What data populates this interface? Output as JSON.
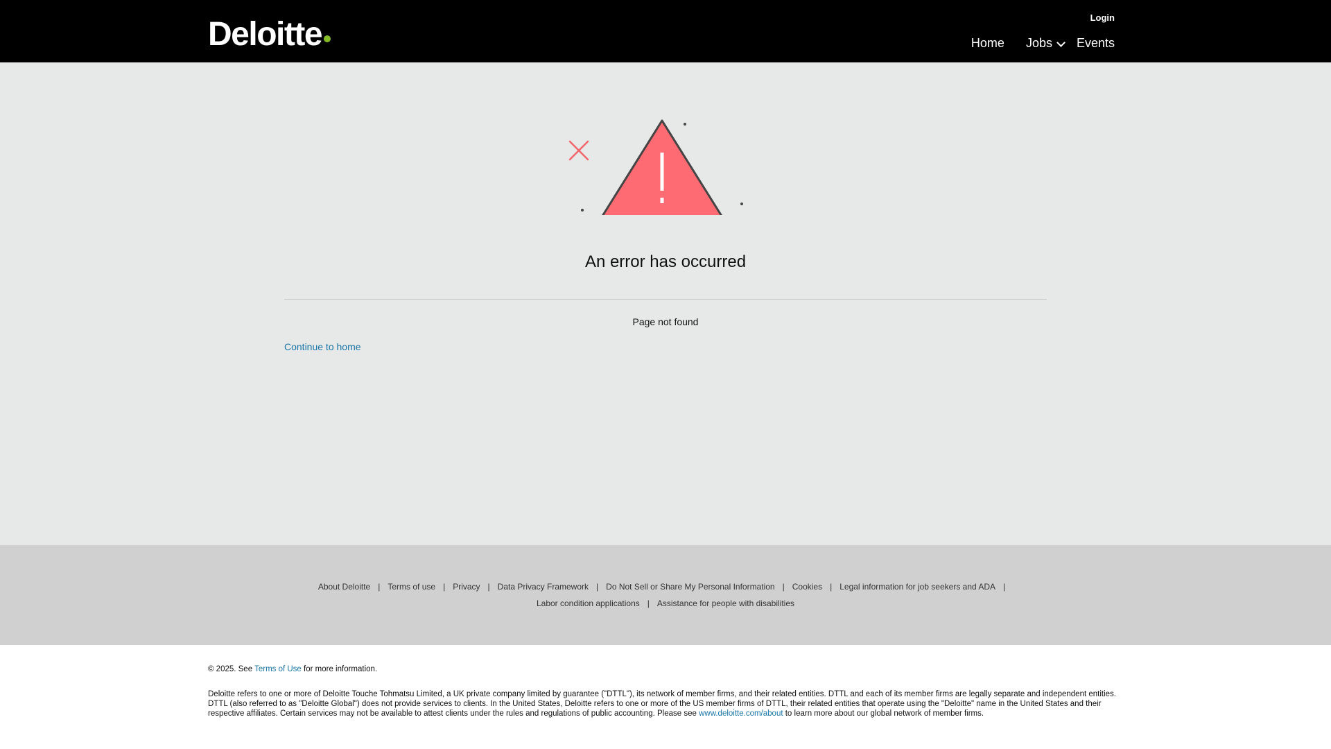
{
  "header": {
    "logo_text": "Deloitte",
    "brand_dot_color": "#86bc25",
    "login_label": "Login",
    "nav": {
      "home_label": "Home",
      "jobs_label": "Jobs",
      "events_label": "Events"
    }
  },
  "error": {
    "title": "An error has occurred",
    "message": "Page not found",
    "continue_label": "Continue to home",
    "icon": "warning-triangle-icon",
    "accent_color": "#ff6b72"
  },
  "footer_links": {
    "row1": [
      "About Deloitte",
      "Terms of use",
      "Privacy",
      "Data Privacy Framework",
      "Do Not Sell or Share My Personal Information",
      "Cookies",
      "Legal information for job seekers and ADA"
    ],
    "row2": [
      "Labor condition applications",
      "Assistance for people with disabilities"
    ],
    "separator": "|"
  },
  "legal": {
    "copyright_prefix": "© 2025. See ",
    "copyright_link": "Terms of Use",
    "copyright_suffix": " for more information.",
    "disclaimer_text": "Deloitte refers to one or more of Deloitte Touche Tohmatsu Limited, a UK private company limited by guarantee (\"DTTL\"), its network of member firms, and their related entities. DTTL and each of its member firms are legally separate and independent entities. DTTL (also referred to as \"Deloitte Global\") does not provide services to clients. In the United States, Deloitte refers to one or more of the US member firms of DTTL, their related entities that operate using the \"Deloitte\" name in the United States and their respective affiliates. Certain services may not be available to attest clients under the rules and regulations of public accounting. Please see ",
    "disclaimer_link": "www.deloitte.com/about",
    "disclaimer_suffix": " to learn more about our global network of member firms."
  }
}
